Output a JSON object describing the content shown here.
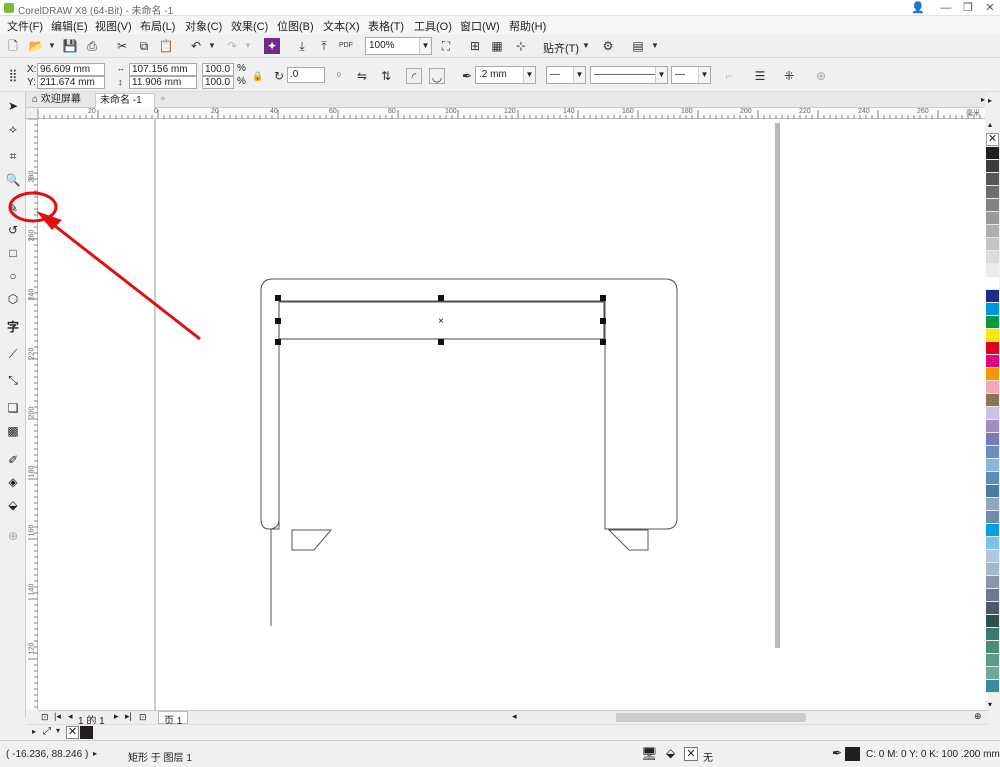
{
  "window": {
    "title": "CorelDRAW X8 (64-Bit) - 未命名 -1"
  },
  "menu": [
    "文件(F)",
    "编辑(E)",
    "视图(V)",
    "布局(L)",
    "对象(C)",
    "效果(C)",
    "位图(B)",
    "文本(X)",
    "表格(T)",
    "工具(O)",
    "窗口(W)",
    "帮助(H)"
  ],
  "toolbar": {
    "zoom": "100%",
    "snap_label": "贴齐(T)",
    "pdf_label": "PDF"
  },
  "propertybar": {
    "x_label": "X:",
    "x_value": "96.609 mm",
    "y_label": "Y:",
    "y_value": "211.674 mm",
    "width_value": "107.156 mm",
    "height_value": "11.906 mm",
    "scale_w": "100.0",
    "scale_h": "100.0",
    "percent": "%",
    "rotation": ".0",
    "outline_width": ".2 mm"
  },
  "tabs": {
    "welcome": "欢迎屏幕",
    "document": "未命名 -1"
  },
  "ruler": {
    "h_ticks": [
      "20",
      "0",
      "20",
      "40",
      "60",
      "80",
      "100",
      "120",
      "140",
      "160",
      "180",
      "200",
      "220",
      "240",
      "260"
    ],
    "h_unit": "毫米",
    "v_ticks": [
      "280",
      "260",
      "240",
      "220",
      "200",
      "180",
      "160",
      "140",
      "120",
      "100"
    ]
  },
  "pagebar": {
    "page_counter": "1 的 1",
    "page_tab": "页 1"
  },
  "status": {
    "coords": "( -16.236, 88.246 )",
    "object_info": "矩形 于 图层 1",
    "fill_none": "无",
    "outline_info": "C: 0 M: 0 Y: 0 K: 100  .200 mm"
  },
  "colors": {
    "annotation_red": "#e01010",
    "palette": [
      "#231f20",
      "#403c3d",
      "#5a5657",
      "#706c6d",
      "#858283",
      "#9b9899",
      "#b0aeaf",
      "#c6c4c5",
      "#dcdadb",
      "#ececec",
      "#ffffff",
      "#1e2d8c",
      "#0096dc",
      "#009a44",
      "#ffe600",
      "#e0001a",
      "#e6007e",
      "#f39800",
      "#f2a6b8",
      "#8b7355",
      "#c9c3e3",
      "#9f8ec2",
      "#7b7bb8",
      "#6c8ec4",
      "#8cb4d8",
      "#5b8db8",
      "#4a7aa6",
      "#8fa6bd",
      "#6f8ca8",
      "#00a0e9",
      "#7ec0ee",
      "#b0c8e0",
      "#a3b8c8",
      "#8898a8",
      "#6a7a8a",
      "#4a5a6a",
      "#2f4f4f",
      "#3a7a6a",
      "#4e8a7a",
      "#5a9a8a",
      "#6aaa9a",
      "#3c8aa0",
      "#2e7a90"
    ]
  }
}
